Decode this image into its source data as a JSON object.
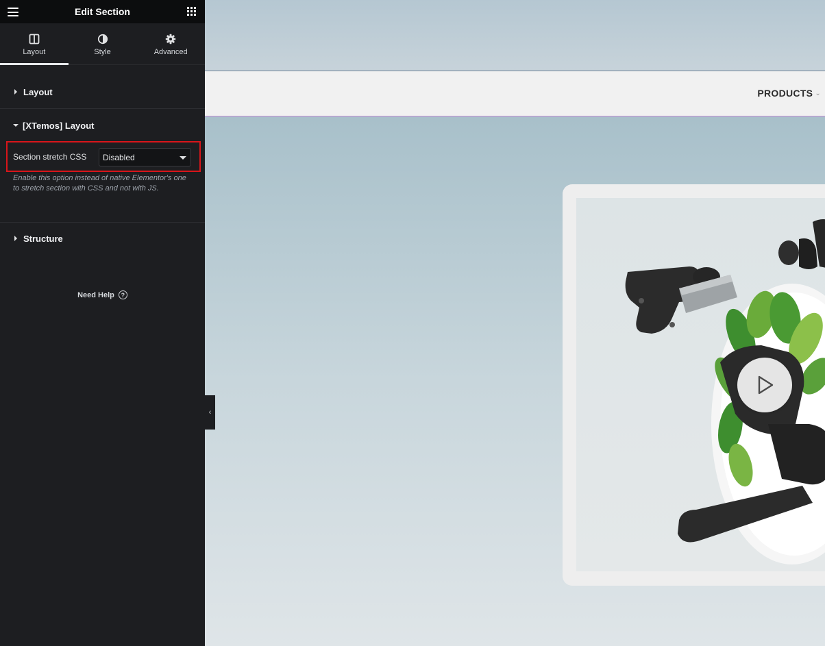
{
  "panel": {
    "header": {
      "title": "Edit Section",
      "menu_icon": "hamburger-menu-icon",
      "widgets_icon": "grid-apps-icon"
    },
    "tabs": [
      {
        "label": "Layout",
        "icon": "layout-columns-icon",
        "active": true
      },
      {
        "label": "Style",
        "icon": "half-circle-contrast-icon",
        "active": false
      },
      {
        "label": "Advanced",
        "icon": "gear-icon",
        "active": false
      }
    ],
    "sections": {
      "layout": {
        "label": "Layout",
        "expanded": false
      },
      "xtemos_layout": {
        "label": "[XTemos] Layout",
        "expanded": true
      },
      "structure": {
        "label": "Structure",
        "expanded": false
      }
    },
    "control": {
      "label": "Section stretch CSS",
      "value": "Disabled",
      "description": "Enable this option instead of native Elementor's one to stretch section with CSS and not with JS."
    },
    "need_help": "Need Help",
    "help_icon_glyph": "?"
  },
  "preview": {
    "nav": {
      "products_label": "PRODUCTS"
    },
    "video": {
      "play_icon": "play-icon"
    }
  },
  "colors": {
    "panel_bg": "#1d1e21",
    "highlight_border": "#d9151a",
    "nav_bg": "#f1f1f1"
  }
}
